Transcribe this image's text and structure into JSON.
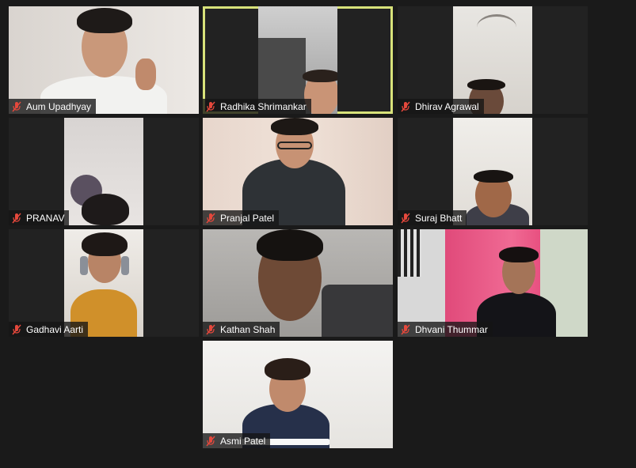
{
  "meeting": {
    "accent_active": "#d8e27a",
    "mute_icon_color": "#e5483c"
  },
  "participants": [
    {
      "name": "Aum Upadhyay",
      "muted": true,
      "active": false
    },
    {
      "name": "Radhika Shrimankar",
      "muted": true,
      "active": true
    },
    {
      "name": "Dhirav Agrawal",
      "muted": true,
      "active": false
    },
    {
      "name": "PRANAV",
      "muted": true,
      "active": false
    },
    {
      "name": "Pranjal Patel",
      "muted": true,
      "active": false
    },
    {
      "name": "Suraj Bhatt",
      "muted": true,
      "active": false
    },
    {
      "name": "Gadhavi Aarti",
      "muted": true,
      "active": false
    },
    {
      "name": "Kathan Shah",
      "muted": true,
      "active": false
    },
    {
      "name": "Dhvani Thummar",
      "muted": true,
      "active": false
    },
    {
      "name": "Asmi Patel",
      "muted": true,
      "active": false
    }
  ]
}
